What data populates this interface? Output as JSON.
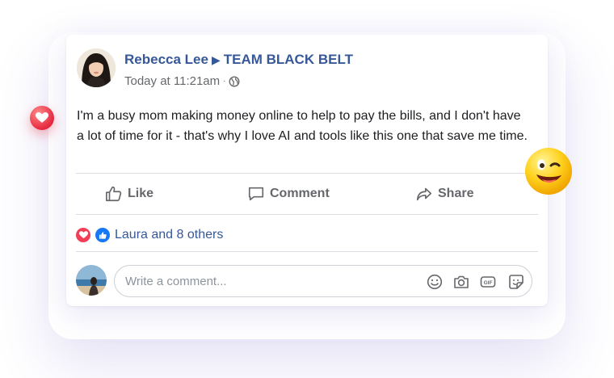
{
  "post": {
    "author": "Rebecca Lee",
    "group": "TEAM BLACK BELT",
    "timestamp": "Today at 11:21am",
    "text": "I'm a busy mom making money online to help to pay the bills, and I don't have a lot of time for it - that's why I love AI and tools like this one that save me time."
  },
  "actions": {
    "like": "Like",
    "comment": "Comment",
    "share": "Share"
  },
  "reactions": {
    "summary": "Laura and 8 others",
    "icons": [
      "love-reaction-icon",
      "like-reaction-icon"
    ]
  },
  "comment_box": {
    "placeholder": "Write a comment..."
  },
  "colors": {
    "brand_blue": "#365899",
    "love_red": "#f33e58",
    "like_blue": "#1877f2",
    "muted": "#65676b"
  }
}
